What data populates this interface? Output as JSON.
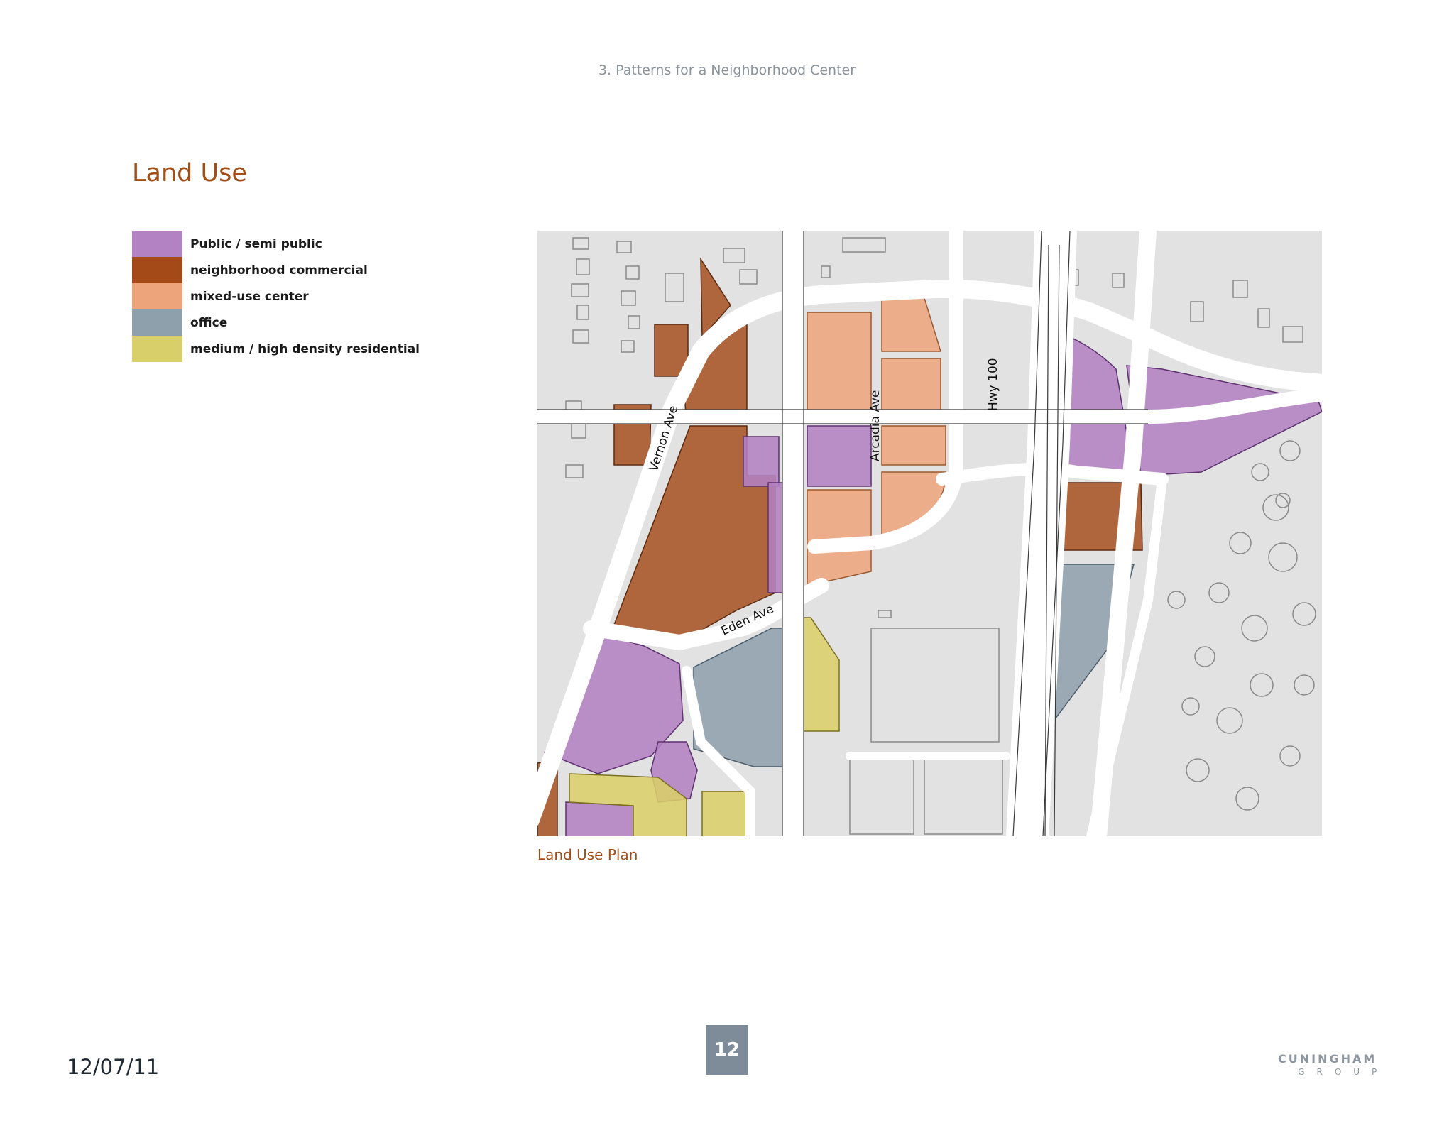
{
  "header": {
    "title": "3. Patterns for a Neighborhood Center"
  },
  "section": {
    "title": "Land Use"
  },
  "legend": {
    "items": [
      {
        "label": "Public / semi public",
        "color": "#b382c2"
      },
      {
        "label": "neighborhood commercial",
        "color": "#a44a19"
      },
      {
        "label": "mixed-use center",
        "color": "#eda47a"
      },
      {
        "label": "office",
        "color": "#8fa0ad"
      },
      {
        "label": "medium / high density residential",
        "color": "#d9cf6a"
      }
    ]
  },
  "map": {
    "caption": "Land Use Plan",
    "street_labels": {
      "vernon": "Vernon Ave",
      "arcadia": "Arcadia Ave",
      "hwy": "Hwy 100",
      "eden": "Eden Ave"
    }
  },
  "footer": {
    "date": "12/07/11",
    "page_number": "12",
    "logo_top": "CUNINGHAM",
    "logo_bottom": "GROUP"
  }
}
